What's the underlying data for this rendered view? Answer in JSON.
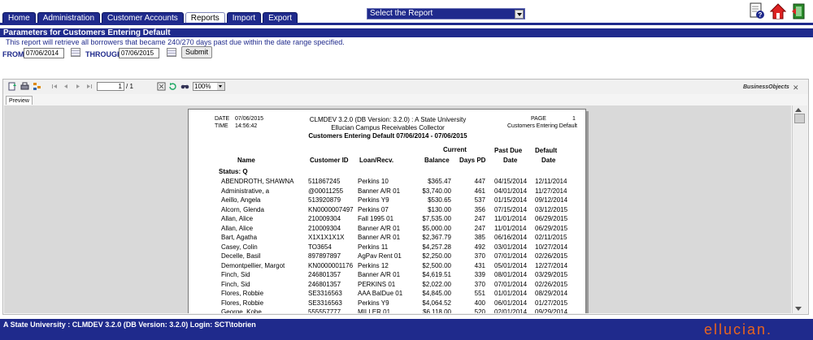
{
  "tabs": [
    {
      "label": "Home",
      "active": false
    },
    {
      "label": "Administration",
      "active": false
    },
    {
      "label": "Customer Accounts",
      "active": false
    },
    {
      "label": "Reports",
      "active": true
    },
    {
      "label": "Import",
      "active": false
    },
    {
      "label": "Export",
      "active": false
    }
  ],
  "report_select": {
    "value": "Select the Report"
  },
  "header_icons": [
    "help-icon",
    "home-icon",
    "logout-icon"
  ],
  "params": {
    "title": "Parameters for Customers Entering Default",
    "description": "This report will retrieve all borrowers that became 240/270 days past due within the date range specified.",
    "from_label": "FROM:",
    "from_value": "07/06/2014",
    "through_label": "THROUGH:",
    "through_value": "07/06/2015",
    "submit": "Submit"
  },
  "viewer": {
    "page_current": "1",
    "page_total": "/ 1",
    "zoom": "100%",
    "brand": "BusinessObjects",
    "preview_tab": "Preview"
  },
  "report": {
    "date_label": "DATE",
    "date_value": "07/06/2015",
    "time_label": "TIME",
    "time_value": "14:56:42",
    "title_line1": "CLMDEV 3.2.0 (DB Version:  3.2.0)  : A State University",
    "title_line2": "Ellucian Campus Receivables Collector",
    "title_line3": "Customers Entering Default 07/06/2014 - 07/06/2015",
    "page_label": "PAGE",
    "page_value": "1",
    "page_subtitle": "Customers Entering Default",
    "columns": {
      "name": "Name",
      "customer_id": "Customer ID",
      "loan": "Loan/Recv.",
      "current": "Current",
      "balance": "Balance",
      "days_pd": "Days PD",
      "past_due1": "Past Due",
      "past_due2": "Date",
      "default1": "Default",
      "default2": "Date"
    },
    "status": "Status: Q",
    "rows": [
      {
        "name": "ABENDROTH, SHAWNA",
        "id": "511867245",
        "loan": "Perkins  10",
        "bal": "$365.47",
        "days": "447",
        "pdd": "04/15/2014",
        "dd": "12/11/2014"
      },
      {
        "name": "Administrative, a",
        "id": "@00011255",
        "loan": "Banner A/R  01",
        "bal": "$3,740.00",
        "days": "461",
        "pdd": "04/01/2014",
        "dd": "11/27/2014"
      },
      {
        "name": "Aeillo, Angela",
        "id": "513920879",
        "loan": "Perkins  Y9",
        "bal": "$530.65",
        "days": "537",
        "pdd": "01/15/2014",
        "dd": "09/12/2014"
      },
      {
        "name": "Alcorn, Glenda",
        "id": "KN0000007497",
        "loan": "Perkins  07",
        "bal": "$130.00",
        "days": "356",
        "pdd": "07/15/2014",
        "dd": "03/12/2015"
      },
      {
        "name": "Allan, Alice",
        "id": "210009304",
        "loan": "Fall 1995  01",
        "bal": "$7,535.00",
        "days": "247",
        "pdd": "11/01/2014",
        "dd": "06/29/2015"
      },
      {
        "name": "Allan, Alice",
        "id": "210009304",
        "loan": "Banner A/R  01",
        "bal": "$5,000.00",
        "days": "247",
        "pdd": "11/01/2014",
        "dd": "06/29/2015"
      },
      {
        "name": "Bart, Agatha",
        "id": "X1X1X1X1X",
        "loan": "Banner A/R  01",
        "bal": "$2,367.79",
        "days": "385",
        "pdd": "06/16/2014",
        "dd": "02/11/2015"
      },
      {
        "name": "Casey, Colin",
        "id": "TO3654",
        "loan": "Perkins  11",
        "bal": "$4,257.28",
        "days": "492",
        "pdd": "03/01/2014",
        "dd": "10/27/2014"
      },
      {
        "name": "Decelle, Basil",
        "id": "897897897",
        "loan": "AgPav Rent  01",
        "bal": "$2,250.00",
        "days": "370",
        "pdd": "07/01/2014",
        "dd": "02/26/2015"
      },
      {
        "name": "Demontpellier, Margot",
        "id": "KN0000001176",
        "loan": "Perkins  12",
        "bal": "$2,500.00",
        "days": "431",
        "pdd": "05/01/2014",
        "dd": "12/27/2014"
      },
      {
        "name": "Finch, Sid",
        "id": "246801357",
        "loan": "Banner A/R  01",
        "bal": "$4,619.51",
        "days": "339",
        "pdd": "08/01/2014",
        "dd": "03/29/2015"
      },
      {
        "name": "Finch, Sid",
        "id": "246801357",
        "loan": "PERKINS  01",
        "bal": "$2,022.00",
        "days": "370",
        "pdd": "07/01/2014",
        "dd": "02/26/2015"
      },
      {
        "name": "Flores, Robbie",
        "id": "SE3316563",
        "loan": "AAA BalDue  01",
        "bal": "$4,845.00",
        "days": "551",
        "pdd": "01/01/2014",
        "dd": "08/29/2014"
      },
      {
        "name": "Flores, Robbie",
        "id": "SE3316563",
        "loan": "Perkins  Y9",
        "bal": "$4,064.52",
        "days": "400",
        "pdd": "06/01/2014",
        "dd": "01/27/2015"
      },
      {
        "name": "George, Kobe",
        "id": "555557777",
        "loan": "MILLER  01",
        "bal": "$6,118.00",
        "days": "520",
        "pdd": "02/01/2014",
        "dd": "09/29/2014"
      }
    ]
  },
  "footer": {
    "status": "A State University : CLMDEV 3.2.0 (DB Version: 3.2.0) Login: SCT\\tobrien",
    "brand": "ellucian."
  }
}
